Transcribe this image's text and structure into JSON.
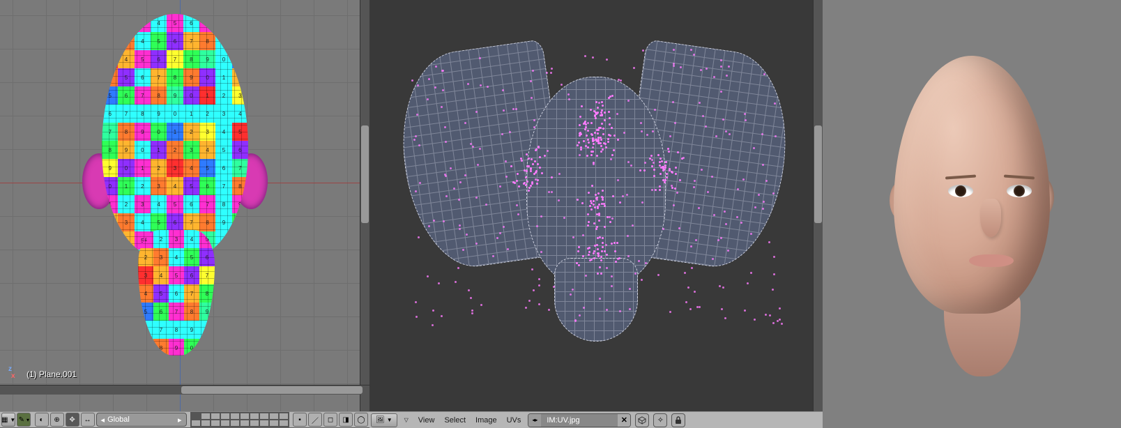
{
  "viewport3d": {
    "object_label": "(1) Plane.001",
    "axes": {
      "vertical": "z",
      "horizontal": "x"
    }
  },
  "toolbar3d": {
    "editor_type": "3D View",
    "mode": "Edit Mode",
    "pivot": "Median Point",
    "orientation_label": "Global",
    "draw_type": "Textured"
  },
  "uv_editor": {
    "editor_type": "UV/Image Editor",
    "menus": {
      "view": "View",
      "select": "Select",
      "image": "Image",
      "uvs": "UVs"
    },
    "image_field": {
      "prefix": "IM:",
      "name": "UV.jpg",
      "display": "IM:UV.jpg"
    },
    "icons": {
      "clear": "✕",
      "cube": "⬚",
      "pin": "📌",
      "lock": "🔒"
    }
  },
  "checker_palette": [
    "#ff2fd1",
    "#2fff57",
    "#2f7bff",
    "#ffb52f",
    "#ffff2f",
    "#2fffff",
    "#ff2f2f",
    "#8f2fff",
    "#2fff9f",
    "#ff7b2f"
  ],
  "checker_digits": [
    "1",
    "2",
    "3",
    "4",
    "5",
    "6",
    "7",
    "8",
    "9",
    "0"
  ]
}
